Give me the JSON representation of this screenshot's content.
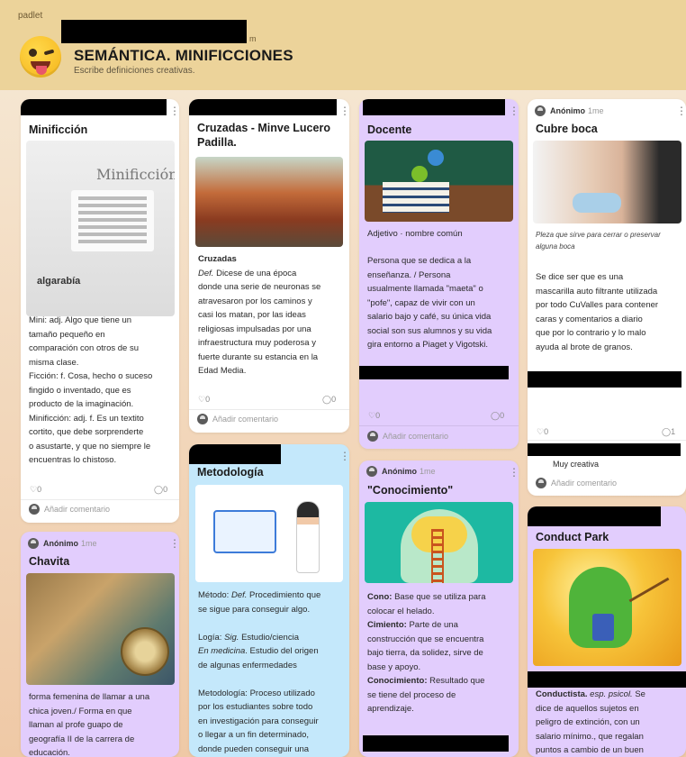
{
  "brand": "padlet",
  "header": {
    "title": "SEMÁNTICA. MINIFICCIONES",
    "subtitle": "Escribe definiciones creativas.",
    "tiny_suffix": "m"
  },
  "common": {
    "likes": "0",
    "comments": "0",
    "comments_one": "1",
    "add_comment": "Añadir comentario",
    "anon": "Anónimo",
    "time": "1me",
    "heart_icon": "♡",
    "comment_icon": "◯",
    "menu": "⋮"
  },
  "cards": {
    "minificcion": {
      "title": "Minificción",
      "image_title": "Minificción",
      "image_brand": "algarabía",
      "body": [
        "Mini: adj. Algo que tiene un",
        "tamaño pequeño en",
        "comparación con otros de su",
        "misma clase.",
        "Ficción: f. Cosa, hecho o suceso",
        "fingido o inventado, que es",
        "producto de la imaginación.",
        "Minificción: adj. f. Es un textito",
        "cortito, que debe sorprenderte",
        "o asustarte, y que no siempre le",
        "encuentras lo chistoso."
      ]
    },
    "chavita": {
      "title": "Chavita",
      "body": [
        "forma femenina de llamar a una",
        "chica joven./ Forma en que",
        "llaman al profe guapo de",
        "geografía II de la carrera de",
        "educación."
      ]
    },
    "cruzadas": {
      "title_line1": "Cruzadas - Minve Lucero",
      "title_line2": "Padilla.",
      "term": "Cruzadas",
      "def_label": "Def.",
      "body": [
        " Dicese de  una época",
        "donde una serie de neuronas se",
        "atravesaron por los caminos y",
        "casi los matan, por las ideas",
        "religiosas impulsadas por una",
        "infraestructura muy poderosa y",
        "fuerte durante su estancia en la",
        "Edad Media."
      ]
    },
    "metodologia": {
      "title": "Metodología",
      "p1_a": "Método: ",
      "p1_def": "Def.",
      "p1_b": " Procedimiento que",
      "p1_c": "se sigue para conseguir algo.",
      "p2_a": "Logía: ",
      "p2_sig": "Sig.",
      "p2_b": " Estudio/ciencia",
      "p2_med": "En medicina",
      "p2_c": ". Estudio del origen",
      "p2_d": "de algunas enfermedades",
      "p3": [
        "Metodología: Proceso utilizado",
        "por los estudiantes sobre todo",
        "en investigación para conseguir",
        "o llegar a un fin determinado,",
        "donde pueden conseguir una"
      ]
    },
    "docente": {
      "title": "Docente",
      "subtitle": "Adjetivo · nombre común",
      "body": [
        "Persona que se dedica a la",
        "enseñanza. / Persona",
        "usualmente llamada \"maeta\" o",
        "\"pofe\", capaz de vivir con un",
        "salario bajo y café, su única vida",
        "social son sus alumnos y su vida",
        "gira entorno a Piaget y Vigotski."
      ]
    },
    "conocimiento": {
      "title": "\"Conocimiento\"",
      "cono_label": "Cono:",
      "cono_a": " Base que se utiliza para",
      "cono_b": "colocar el helado.",
      "cim_label": "Cimiento:",
      "cim_a": " Parte de una",
      "cim_b": "construcción que se encuentra",
      "cim_c": "bajo tierra, da solidez, sirve de",
      "cim_d": "base y apoyo.",
      "con_label": "Conocimiento:",
      "con_a": " Resultado que",
      "con_b": "se tiene del proceso de",
      "con_c": "aprendizaje."
    },
    "cubreboca": {
      "title": "Cubre boca",
      "caption": [
        "Pleza que sirve para cerrar o preservar",
        "alguna boca"
      ],
      "body": [
        "Se dice ser que es una",
        "mascarilla auto filtrante utilizada",
        "por todo CuValles para contener",
        "caras y comentarios a diario",
        "que por lo contrario y lo malo",
        "ayuda al brote de granos."
      ],
      "comment_text": "Muy creativa"
    },
    "conduct": {
      "title": "Conduct Park",
      "term": "Conductista.",
      "abbr": " esp. psicol.",
      "body_a": " Se",
      "body": [
        "dice de aquellos sujetos en",
        "peligro de extinción, con un",
        "salario mínimo., que regalan",
        "puntos a cambio de un buen"
      ]
    }
  },
  "colors": {
    "header": "#ecd39a",
    "purple_card": "#e2cdfd",
    "blue_card": "#c4e8fb",
    "white_card": "#ffffff"
  }
}
